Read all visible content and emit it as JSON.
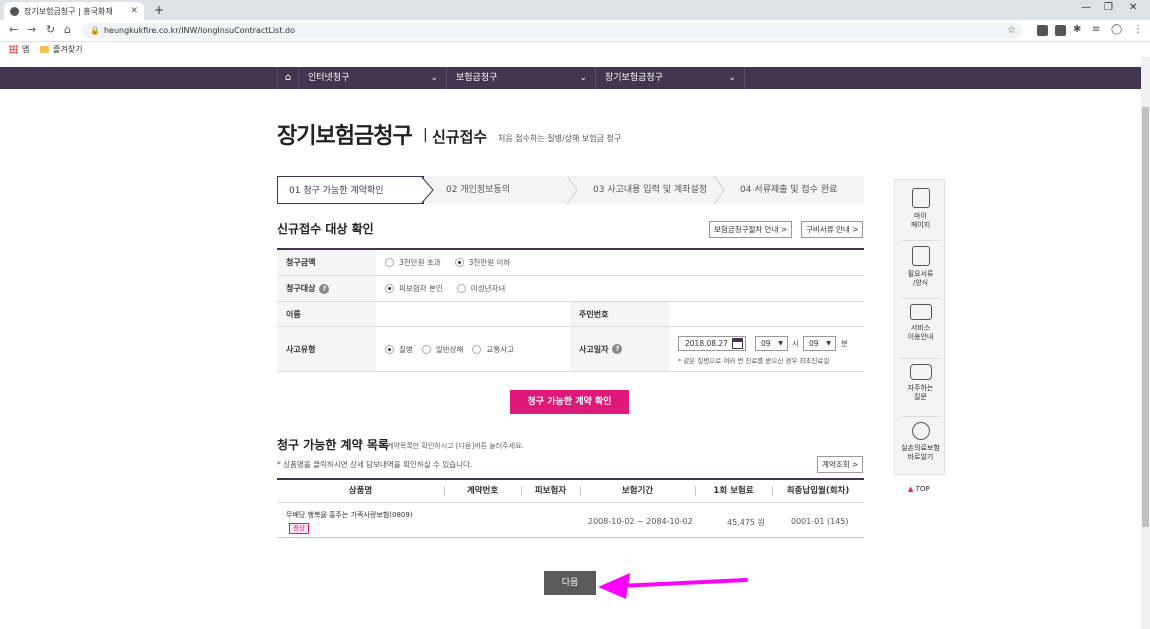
{
  "browser": {
    "tab_title": "장기보험금청구 | 흥국화재",
    "url": "heungkukfire.co.kr/INW/longInsuContractList.do",
    "bookmarks": [
      "앱",
      "즐겨찾기"
    ]
  },
  "nav": {
    "items": [
      "인터넷청구",
      "보험금청구",
      "장기보험금청구"
    ]
  },
  "page": {
    "title": "장기보험금청구",
    "subtitle": "신규접수",
    "description": "처음 접수하는 질병/상해 보험금 청구"
  },
  "steps": [
    {
      "label": "01 청구 가능한 계약확인",
      "active": true
    },
    {
      "label": "02 개인정보동의",
      "active": false
    },
    {
      "label": "03 사고내용 입력 및 계좌설정",
      "active": false
    },
    {
      "label": "04 서류제출 및 접수 완료",
      "active": false
    }
  ],
  "form": {
    "section_title": "신규접수 대상 확인",
    "guide_button": "보험금청구절차 안내 >",
    "docs_button": "구비서류 안내 >",
    "amount_label": "청구금액",
    "amount_options": [
      {
        "label": "3천만원 초과",
        "checked": false
      },
      {
        "label": "3천만원 이하",
        "checked": true
      }
    ],
    "target_label": "청구대상",
    "target_options": [
      {
        "label": "피보험자 본인",
        "checked": true
      },
      {
        "label": "미성년자녀",
        "checked": false
      }
    ],
    "name_label": "이름",
    "rrn_label": "주민번호",
    "accident_type_label": "사고유형",
    "accident_type_options": [
      {
        "label": "질병",
        "checked": true
      },
      {
        "label": "일반상해",
        "checked": false
      },
      {
        "label": "교통사고",
        "checked": false
      }
    ],
    "accident_date_label": "사고일자",
    "date_value": "2018.08.27",
    "hour_value": "09",
    "hour_unit": "시",
    "minute_value": "09",
    "minute_unit": "분",
    "date_note": "* 같은 질병으로 여러 번 진료를 받으신 경우 최초진료일",
    "help_icon_text": "?",
    "check_button": "청구 가능한 계약 확인"
  },
  "list": {
    "title": "청구 가능한 계약 목록",
    "description": "계약목록만 확인하시고 [다음]버튼 눌러주세요.",
    "note": "* 상품명을 클릭하시면 상세 담보내역을 확인하실 수 있습니다.",
    "lookup_button": "계약조회 >",
    "columns": [
      "상품명",
      "계약번호",
      "피보험자",
      "보험기간",
      "1회 보험료",
      "최종납입월(회차)"
    ],
    "rows": [
      {
        "product": "무배당 행복을 홍주는 가족사랑보험(0809)",
        "status": "정상",
        "contract_no": "",
        "insured": "",
        "period": "2008-10-02 ~ 2084-10-02",
        "premium": "45,475 원",
        "last_paid": "0001-01 (145)"
      }
    ]
  },
  "next_button": "다음",
  "quick_menu": {
    "items": [
      "마이\n페이지",
      "필요서류\n/양식",
      "서비스\n이용안내",
      "자주하는\n질문",
      "실손의료보험\n바로알기"
    ],
    "top": "TOP"
  },
  "colors": {
    "brand": "#43344f",
    "accent": "#e2177a",
    "annotation_arrow": "#ff00ff"
  }
}
